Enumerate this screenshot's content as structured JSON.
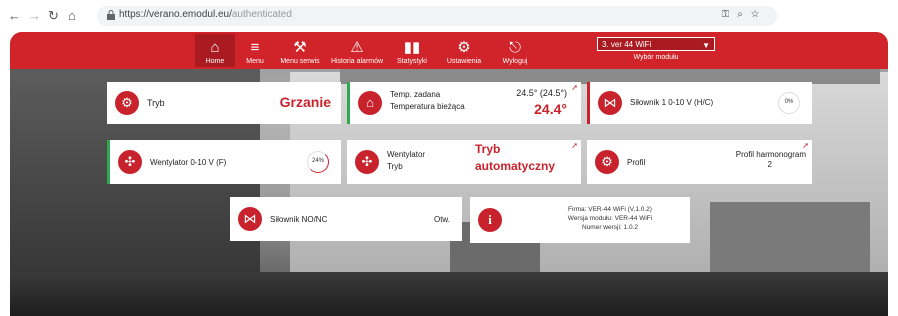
{
  "browser": {
    "url_main": "https://verano.emodul.eu/",
    "url_path": "authenticated",
    "back_icon": "arrow-left-icon",
    "forward_icon": "arrow-right-icon",
    "reload_icon": "reload-icon",
    "home_icon": "home-icon"
  },
  "nav": {
    "items": [
      {
        "label": "Home",
        "icon": "⌂"
      },
      {
        "label": "Menu",
        "icon": "≡"
      },
      {
        "label": "Menu serwis",
        "icon": "⚒"
      },
      {
        "label": "Historia alarmów",
        "icon": "⚠"
      },
      {
        "label": "Statystyki",
        "icon": "▮"
      },
      {
        "label": "Ustawienia",
        "icon": "⚙"
      },
      {
        "label": "Wyloguj",
        "icon": "⎋"
      }
    ],
    "module_select": "3. ver 44 WiFi",
    "module_label": "Wybór modułu"
  },
  "tiles": {
    "tryb": {
      "label": "Tryb",
      "value": "Grzanie"
    },
    "temp": {
      "label1": "Temp. zadana",
      "label2": "Temperatura bieżąca",
      "set": "24.5° (24.5°)",
      "current": "24.4°"
    },
    "silownik1": {
      "label": "Siłownik 1 0-10 V (H/C)",
      "gauge": "0%"
    },
    "wentylator": {
      "label": "Wentylator 0-10 V (F)",
      "gauge": "24%"
    },
    "wentylator_tryb": {
      "label1": "Wentylator",
      "label2": "Tryb",
      "value_line1": "Tryb",
      "value_line2": "automatyczny"
    },
    "profil": {
      "label": "Profil",
      "value_line1": "Profil harmonogram",
      "value_line2": "2"
    },
    "silownik_nonc": {
      "label": "Siłownik NO/NC",
      "value": "Otw."
    },
    "info": {
      "line1": "Firma: VER-44 WiFi (V.1.0.2)",
      "line2": "Wersja modułu: VER-44 WiFi",
      "line3": "Numer wersji: 1.0.2"
    }
  },
  "colors": {
    "accent": "#d1232a"
  }
}
